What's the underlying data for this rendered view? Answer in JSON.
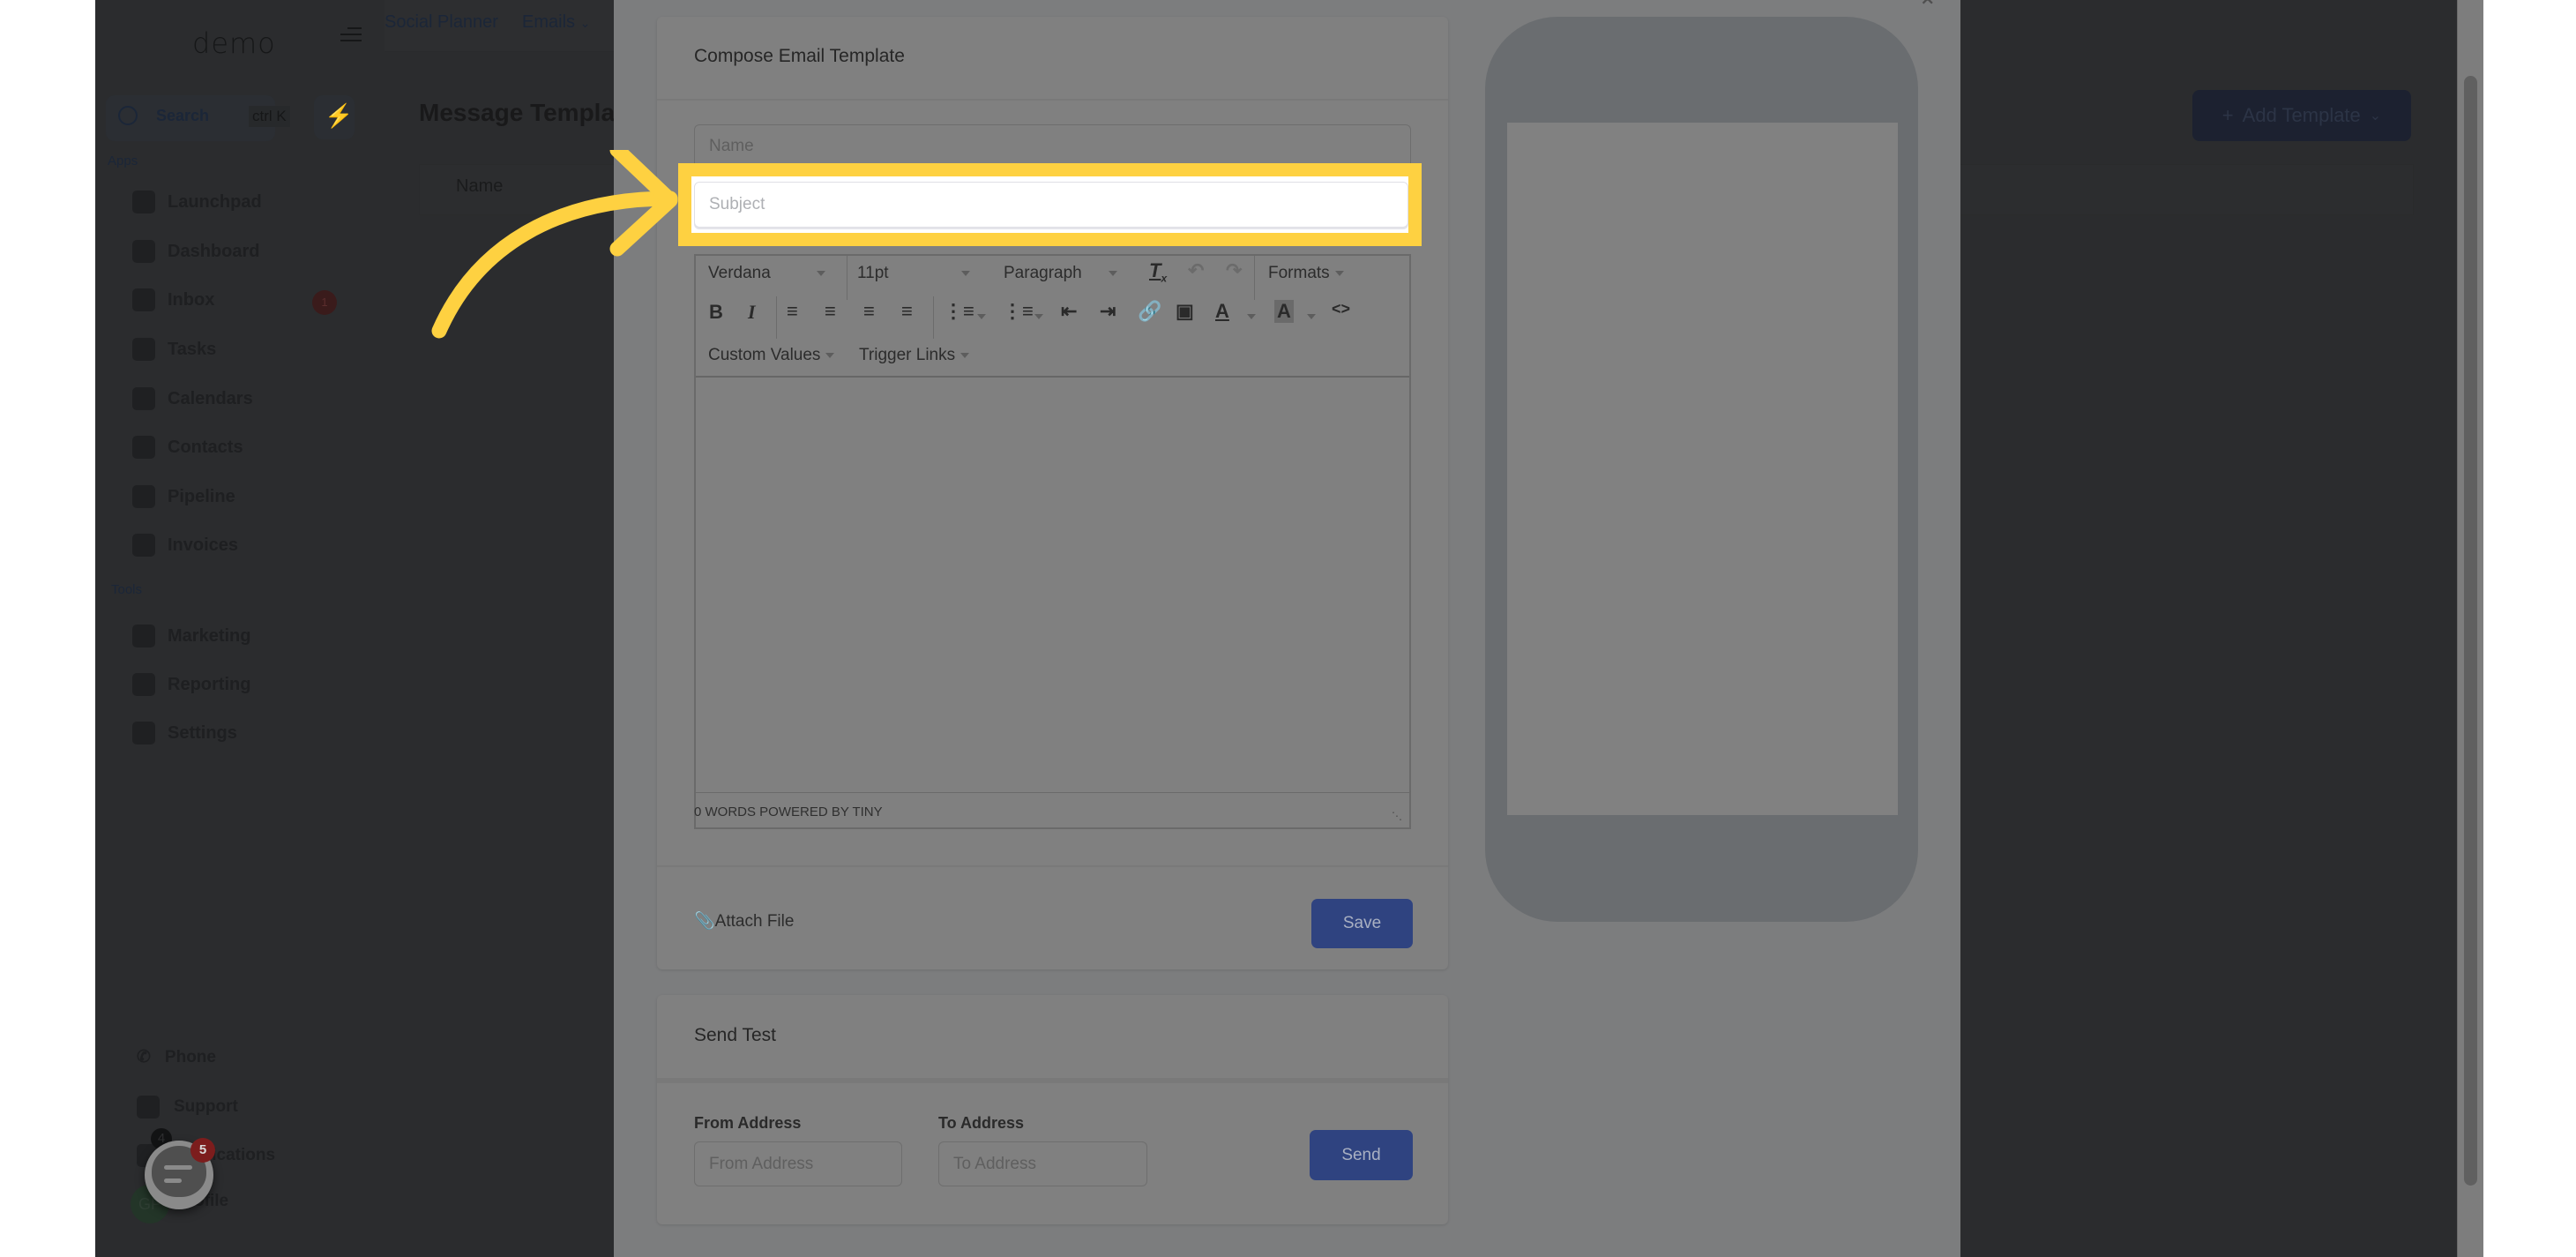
{
  "background_app": {
    "logo": "demo",
    "topnav": {
      "items": [
        "Social Planner",
        "Emails"
      ]
    },
    "search": {
      "label": "Search",
      "shortcut": "ctrl K"
    },
    "sidebar": {
      "sections": [
        "Apps",
        "Tools"
      ],
      "apps": [
        {
          "label": "Launchpad",
          "icon": "launchpad-icon"
        },
        {
          "label": "Dashboard",
          "icon": "dashboard-icon"
        },
        {
          "label": "Inbox",
          "icon": "inbox-icon",
          "badge": "1"
        },
        {
          "label": "Tasks",
          "icon": "tasks-icon"
        },
        {
          "label": "Calendars",
          "icon": "calendar-icon"
        },
        {
          "label": "Contacts",
          "icon": "contacts-icon"
        },
        {
          "label": "Pipeline",
          "icon": "pipeline-icon"
        },
        {
          "label": "Invoices",
          "icon": "invoices-icon"
        }
      ],
      "tools": [
        {
          "label": "Marketing",
          "icon": "megaphone-icon"
        },
        {
          "label": "Reporting",
          "icon": "pie-chart-icon"
        },
        {
          "label": "Settings",
          "icon": "gear-icon"
        }
      ],
      "bottom": [
        {
          "label": "Phone",
          "icon": "phone-icon"
        },
        {
          "label": "Support",
          "icon": "support-icon"
        },
        {
          "label": "Notifications",
          "icon": "bell-icon",
          "badge": "4"
        },
        {
          "label": "Profile",
          "icon": "avatar",
          "initials": "GP"
        }
      ]
    },
    "page_title": "Message Templates",
    "table_headers": [
      "Name"
    ],
    "add_template_label": "Add Template",
    "chat_widget_badge": "5"
  },
  "modal": {
    "compose": {
      "title": "Compose Email Template",
      "name_placeholder": "Name",
      "subject_placeholder": "Subject",
      "toolbar": {
        "font_family": "Verdana",
        "font_size": "11pt",
        "block_format": "Paragraph",
        "formats_label": "Formats",
        "custom_values_label": "Custom Values",
        "trigger_links_label": "Trigger Links"
      },
      "status_bar": "0 WORDS POWERED BY TINY",
      "attach_label": "Attach File",
      "save_label": "Save"
    },
    "send_test": {
      "title": "Send Test",
      "from_label": "From Address",
      "from_placeholder": "From Address",
      "to_label": "To Address",
      "to_placeholder": "To Address",
      "send_label": "Send"
    }
  },
  "annotation": {
    "highlight_color": "#fed141",
    "target": "subject-input"
  }
}
